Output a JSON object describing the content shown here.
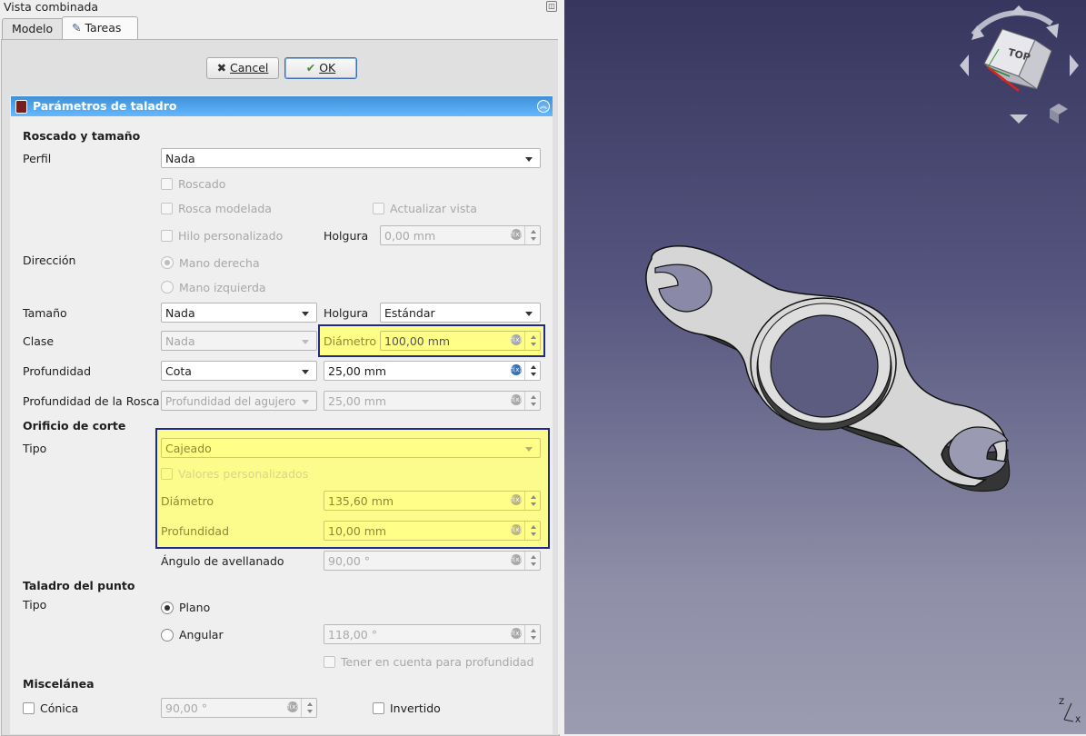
{
  "dock": {
    "title": "Vista combinada"
  },
  "tabs": [
    {
      "label": "Modelo"
    },
    {
      "label": "Tareas"
    }
  ],
  "buttons": {
    "cancel": "Cancel",
    "ok": "OK"
  },
  "panel": {
    "title": "Parámetros de taladro"
  },
  "threading": {
    "section": "Roscado y tamaño",
    "profile_label": "Perfil",
    "profile_value": "Nada",
    "threaded": "Roscado",
    "modeled_thread": "Rosca modelada",
    "update_view": "Actualizar vista",
    "custom_thread": "Hilo personalizado",
    "clearance_label": "Holgura",
    "clearance_value": "0,00 mm",
    "direction_label": "Dirección",
    "right_hand": "Mano derecha",
    "left_hand": "Mano izquierda",
    "size_label": "Tamaño",
    "size_value": "Nada",
    "fit_label": "Holgura",
    "fit_value": "Estándar",
    "class_label": "Clase",
    "class_value": "Nada",
    "diameter_label": "Diámetro",
    "diameter_value": "100,00 mm",
    "depth_label": "Profundidad",
    "depth_mode": "Cota",
    "depth_value": "25,00 mm",
    "thread_depth_label": "Profundidad de la Rosca",
    "thread_depth_mode": "Profundidad del agujero",
    "thread_depth_value": "25,00 mm"
  },
  "cut": {
    "section": "Orificio de corte",
    "type_label": "Tipo",
    "type_value": "Cajeado",
    "custom_values": "Valores personalizados",
    "diameter_label": "Diámetro",
    "diameter_value": "135,60 mm",
    "depth_label": "Profundidad",
    "depth_value": "10,00 mm",
    "countersink_label": "Ángulo de avellanado",
    "countersink_value": "90,00 °"
  },
  "point": {
    "section": "Taladro del punto",
    "type_label": "Tipo",
    "flat": "Plano",
    "angled": "Angular",
    "angle_value": "118,00 °",
    "include_depth": "Tener en cuenta para profundidad"
  },
  "misc": {
    "section": "Miscelánea",
    "tapered": "Cónica",
    "taper_value": "90,00 °",
    "reversed": "Invertido"
  },
  "navcube": {
    "face": "TOP"
  },
  "axes": {
    "x": "X",
    "z": "Z"
  }
}
